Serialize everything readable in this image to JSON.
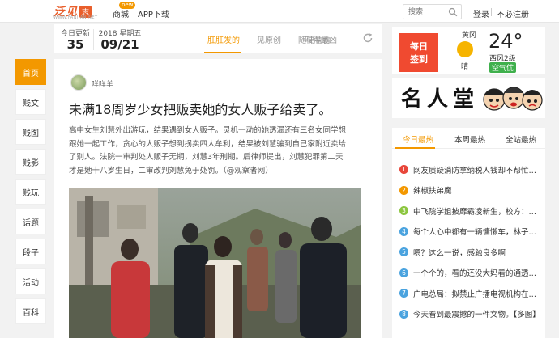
{
  "header": {
    "logo_text": "泛见",
    "logo_badge": "志",
    "logo_sub": "WWW.FANJIAN.NET",
    "nav": [
      {
        "label": "商城",
        "tag": "new"
      },
      {
        "label": "APP下载"
      }
    ],
    "search_placeholder": "搜索",
    "login": "登录",
    "no_register": "不必注册"
  },
  "left_nav": {
    "items": [
      "首页",
      "贱文",
      "贱图",
      "贱影",
      "贱玩",
      "话题",
      "段子",
      "活动",
      "百科"
    ],
    "active_index": 0
  },
  "date_bar": {
    "today_label": "今日更新",
    "today_count": "35",
    "date_top": "2018 星期五",
    "date_big": "09/21",
    "tabs": [
      "肛肛发的",
      "见原创",
      "叫得最凶",
      "随便看看"
    ],
    "active_tab": 0
  },
  "article": {
    "author": "咩咩羊",
    "title": "未满18周岁少女把贩卖她的女人贩子给卖了。",
    "body_lines": [
      "高中女生刘慧外出游玩，结果遇到女人贩子。灵机一动的她透漏还有三名女同学想",
      "跟她一起工作，贪心的人贩子想到拐卖四人牟利，结果被刘慧骗到自己家附近卖给",
      "了别人。法院一审判处人贩子无期，刘慧3年刑期。后律师提出，刘慧犯罪第二天",
      "才是她十八岁生日，二审改判刘慧免于处罚。（@观察者网）"
    ]
  },
  "weather": {
    "sign_lines": [
      "每日",
      "签到"
    ],
    "city": "黄冈",
    "condition": "晴",
    "temperature": "24°",
    "wind": "西风2级",
    "aqi": "空气优",
    "colors": {
      "sign": "#f04a30",
      "sun": "#f6b400",
      "aqi": "#3fb04c"
    }
  },
  "banner": {
    "text": "名人堂"
  },
  "hot": {
    "tabs": [
      "今日最热",
      "本周最热",
      "全站最热"
    ],
    "active_tab": 0,
    "items": [
      "网友质疑消防拿纳税人钱却不帮忙开...",
      "辣椒扶弟魔",
      "中飞院学姐披靡霸凌新生，校方：立...",
      "每个人心中都有一辆慵懒车，林子祥...",
      "嗯？这么一说，感触良多啊",
      "一个个的，看的还没大妈看的通透【...",
      "广电总局：拟禁止广播电视机构在黄...",
      "今天看到最震撼的一件文物。【多图】"
    ],
    "number_colors": [
      "#e8463a",
      "#f39800",
      "#8cc63f",
      "#4aa3df",
      "#4aa3df",
      "#4aa3df",
      "#4aa3df",
      "#4aa3df"
    ]
  }
}
